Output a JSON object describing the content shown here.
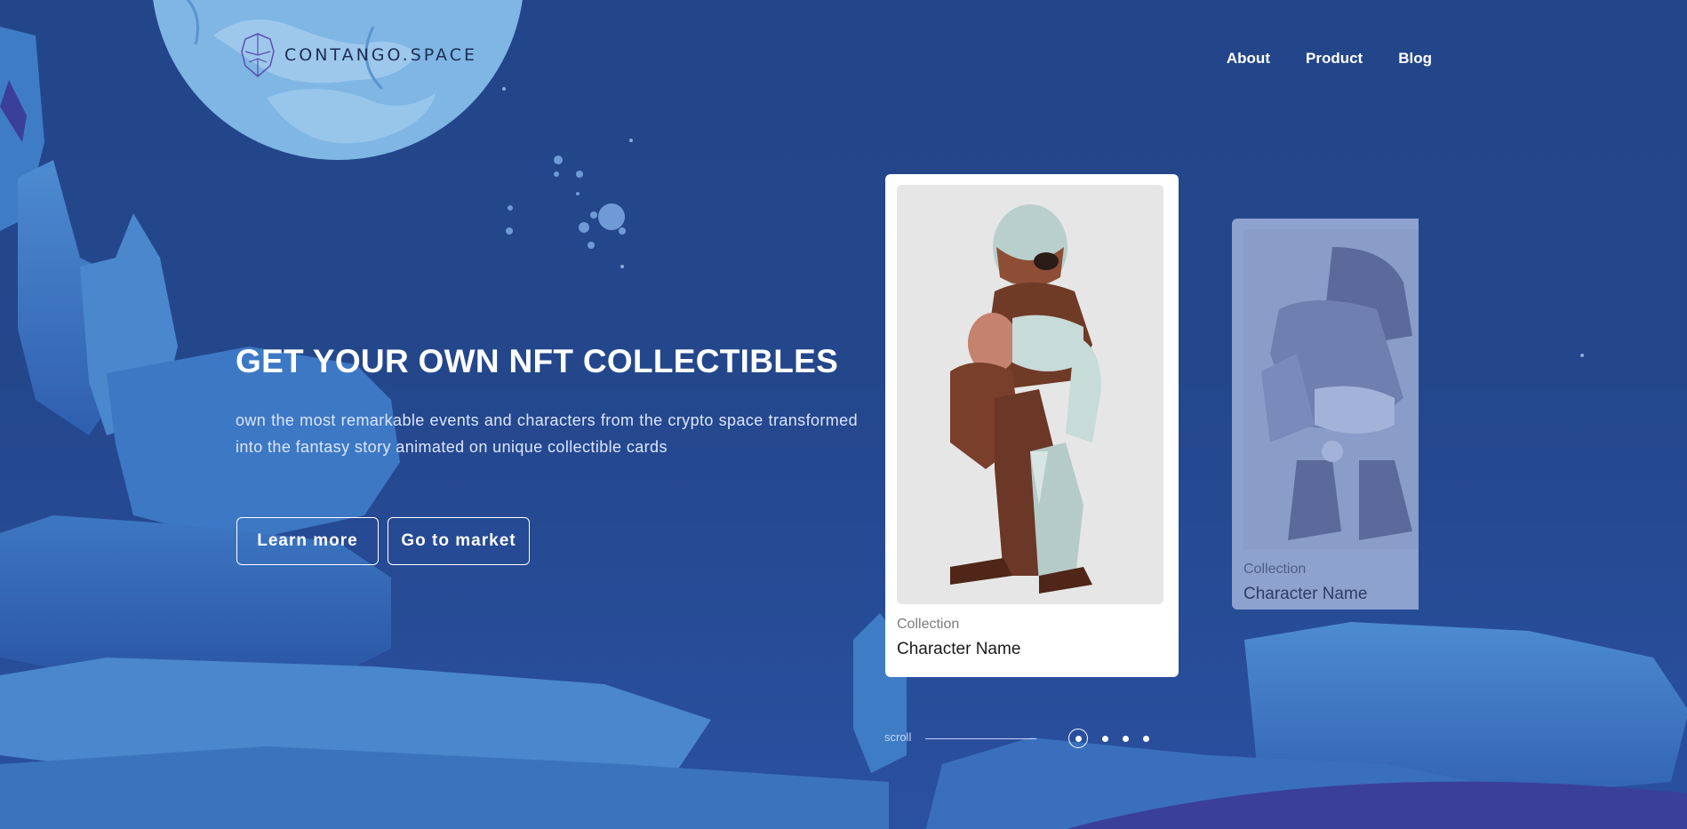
{
  "brand": {
    "name": "CONTANGO.SPACE",
    "logo_icon": "robot-head-icon"
  },
  "nav": {
    "items": [
      {
        "label": "About"
      },
      {
        "label": "Product"
      },
      {
        "label": "Blog"
      }
    ]
  },
  "hero": {
    "headline": "GET YOUR OWN NFT COLLECTIBLES",
    "subtext": "own the most remarkable events and characters from the crypto space transformed into the fantasy story animated on unique collectible cards",
    "learn_more_label": "Learn more",
    "go_to_market_label": "Go to market"
  },
  "cards": [
    {
      "collection": "Collection",
      "name": "Character Name"
    },
    {
      "collection": "Collection",
      "name": "Character Name"
    }
  ],
  "pager": {
    "scroll_label": "scroll",
    "total": 4,
    "active": 1
  },
  "colors": {
    "background": "#23468a",
    "moon": "#7fb6e4",
    "rocks": "#4a86c9",
    "card": "#ffffff"
  }
}
